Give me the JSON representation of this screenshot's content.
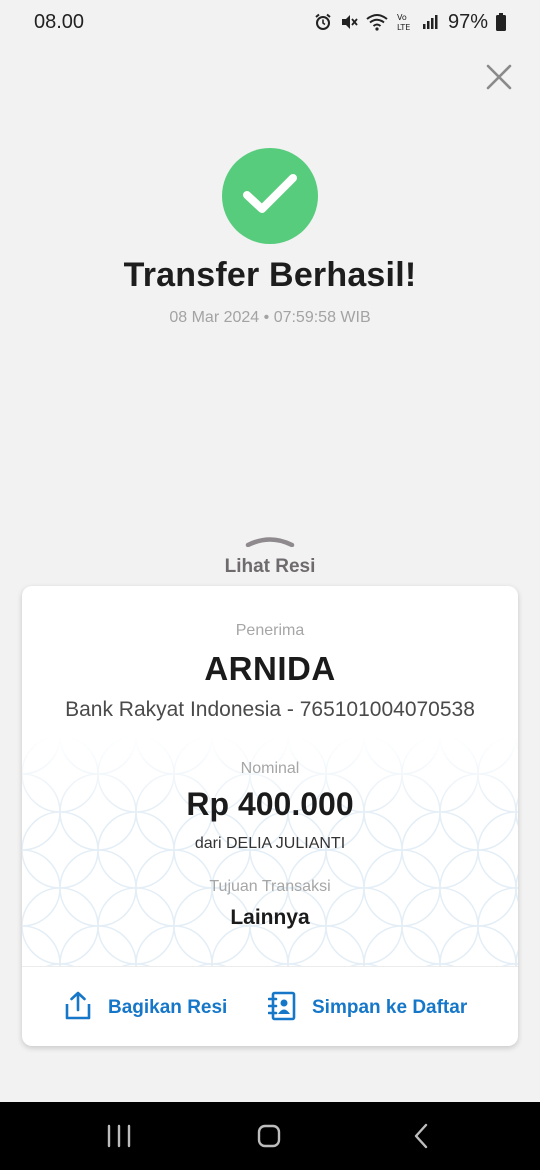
{
  "status_bar": {
    "time": "08.00",
    "battery": "97%",
    "icons": [
      "alarm-icon",
      "mute-icon",
      "wifi-icon",
      "volte-icon",
      "signal-icon",
      "battery-icon"
    ]
  },
  "header": {
    "close_icon": "close-icon"
  },
  "result": {
    "icon": "check-icon",
    "title": "Transfer Berhasil!",
    "datetime": "08 Mar 2024 • 07:59:58 WIB",
    "accent_color": "#57cc7c"
  },
  "receipt_toggle": {
    "label": "Lihat Resi",
    "icon": "chevron-up-icon"
  },
  "receipt": {
    "recipient_label": "Penerima",
    "recipient_name": "ARNIDA",
    "recipient_bank": "Bank Rakyat Indonesia - 765101004070538",
    "amount_label": "Nominal",
    "amount": "Rp 400.000",
    "from": "dari DELIA JULIANTI",
    "purpose_label": "Tujuan Transaksi",
    "purpose": "Lainnya"
  },
  "actions": {
    "share_label": "Bagikan Resi",
    "share_icon": "share-icon",
    "save_label": "Simpan ke Daftar",
    "save_icon": "contact-book-icon",
    "accent_color": "#1677c9"
  },
  "nav_bar": {
    "recent_icon": "recent-apps-icon",
    "home_icon": "home-icon",
    "back_icon": "back-icon"
  }
}
